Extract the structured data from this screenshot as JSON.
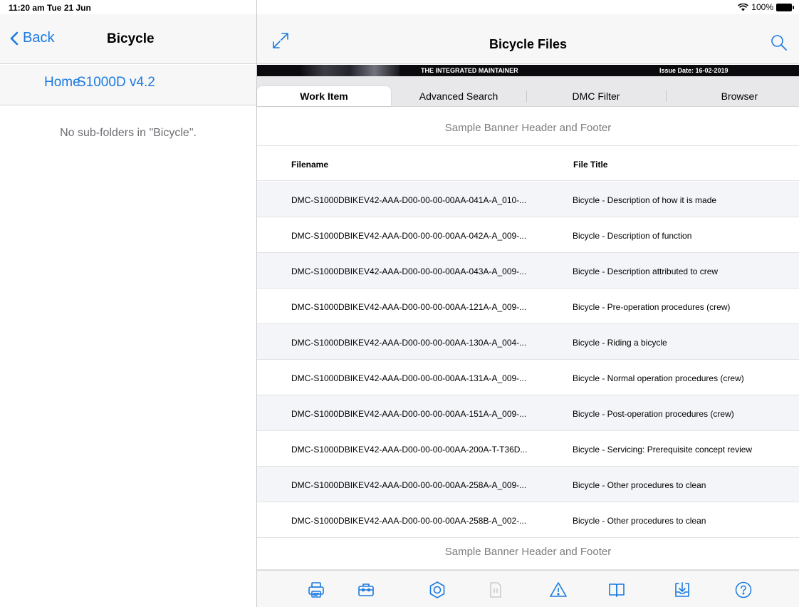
{
  "status": {
    "time": "11:20 am  Tue 21 Jun",
    "battery": "100%"
  },
  "left": {
    "back_label": "Back",
    "title": "Bicycle",
    "breadcrumbs": [
      "Home",
      "S1000D v4.2"
    ],
    "empty_message": "No sub-folders in \"Bicycle\"."
  },
  "right": {
    "title": "Bicycle Files",
    "banner": {
      "title": "THE INTEGRATED MAINTAINER",
      "issue": "Issue Date: 16-02-2019"
    },
    "tabs": [
      "Work Item",
      "Advanced Search",
      "DMC Filter",
      "Browser"
    ],
    "banner_row": "Sample Banner Header and Footer",
    "columns": [
      "Filename",
      "File Title"
    ],
    "rows": [
      {
        "filename": "DMC-S1000DBIKEV42-AAA-D00-00-00-00AA-041A-A_010-...",
        "title": "Bicycle - Description of how it is made"
      },
      {
        "filename": "DMC-S1000DBIKEV42-AAA-D00-00-00-00AA-042A-A_009-...",
        "title": "Bicycle - Description of function"
      },
      {
        "filename": "DMC-S1000DBIKEV42-AAA-D00-00-00-00AA-043A-A_009-...",
        "title": "Bicycle - Description attributed to crew"
      },
      {
        "filename": "DMC-S1000DBIKEV42-AAA-D00-00-00-00AA-121A-A_009-...",
        "title": "Bicycle - Pre-operation procedures (crew)"
      },
      {
        "filename": "DMC-S1000DBIKEV42-AAA-D00-00-00-00AA-130A-A_004-...",
        "title": "Bicycle - Riding a bicycle"
      },
      {
        "filename": "DMC-S1000DBIKEV42-AAA-D00-00-00-00AA-131A-A_009-...",
        "title": "Bicycle - Normal operation procedures (crew)"
      },
      {
        "filename": "DMC-S1000DBIKEV42-AAA-D00-00-00-00AA-151A-A_009-...",
        "title": "Bicycle - Post-operation procedures (crew)"
      },
      {
        "filename": "DMC-S1000DBIKEV42-AAA-D00-00-00-00AA-200A-T-T36D...",
        "title": "Bicycle - Servicing: Prerequisite concept review"
      },
      {
        "filename": "DMC-S1000DBIKEV42-AAA-D00-00-00-00AA-258A-A_009-...",
        "title": "Bicycle - Other procedures to clean"
      },
      {
        "filename": "DMC-S1000DBIKEV42-AAA-D00-00-00-00AA-258B-A_002-...",
        "title": "Bicycle - Other procedures to clean"
      }
    ],
    "toolbar_icons": [
      "printer-icon",
      "toolbox-icon",
      "hexagon-nut-icon",
      "document-icon",
      "warning-icon",
      "book-icon",
      "download-icon",
      "help-icon"
    ]
  },
  "colors": {
    "accent": "#1a7ae0",
    "nav_bg": "#f7f7f7",
    "row_alt": "#f4f5f8"
  }
}
